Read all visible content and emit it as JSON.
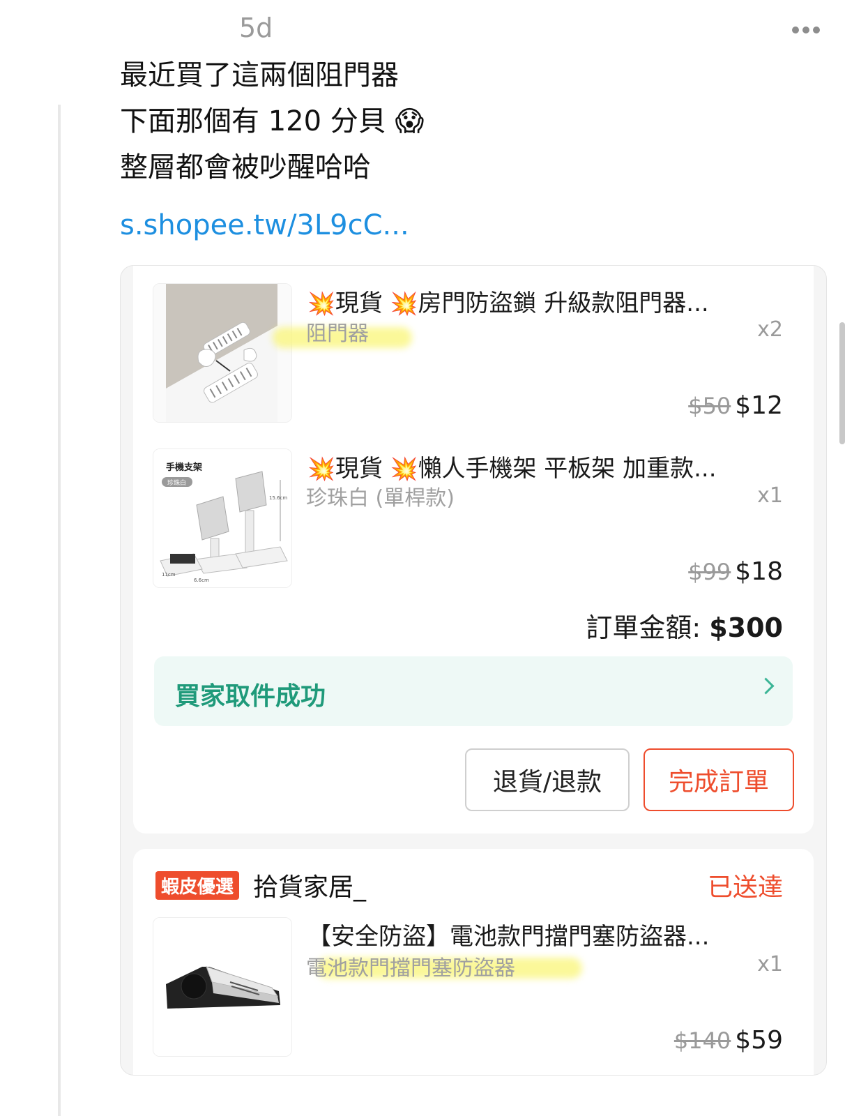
{
  "post": {
    "time": "5d",
    "lines": [
      "最近買了這兩個阻門器",
      "下面那個有 120 分貝",
      "整層都會被吵醒哈哈"
    ],
    "emoji": "😱",
    "link": "s.shopee.tw/3L9cC..."
  },
  "order1": {
    "items": [
      {
        "burst": "💥",
        "title_a": "現貨",
        "title_b": "房門防盜鎖 升級款阻門器...",
        "variant": "阻門器",
        "qty": "x2",
        "original_price": "$50",
        "price": "$12"
      },
      {
        "burst": "💥",
        "title_a": "現貨",
        "title_b": "懶人手機架 平板架  加重款...",
        "variant": "珍珠白 (單桿款)",
        "qty": "x1",
        "original_price": "$99",
        "price": "$18",
        "image_text": {
          "title": "手機支架",
          "tag": "珍珠白",
          "h": "15.6cm",
          "w1": "11cm",
          "w2": "6.6cm"
        }
      }
    ],
    "total_label": "訂單金額: ",
    "total_value": "$300",
    "status": "買家取件成功",
    "refund_button": "退貨/退款",
    "complete_button": "完成訂單"
  },
  "order2": {
    "badge": "蝦皮優選",
    "shop": "拾貨家居_",
    "status": "已送達",
    "item": {
      "title": "【安全防盜】電池款門擋門塞防盜器...",
      "variant": "電池款門擋門塞防盜器",
      "qty": "x1",
      "original_price": "$140",
      "price": "$59"
    }
  },
  "colors": {
    "accent": "#ee4d2d",
    "link": "#1d8fe0",
    "status_green": "#1f9a7a"
  }
}
